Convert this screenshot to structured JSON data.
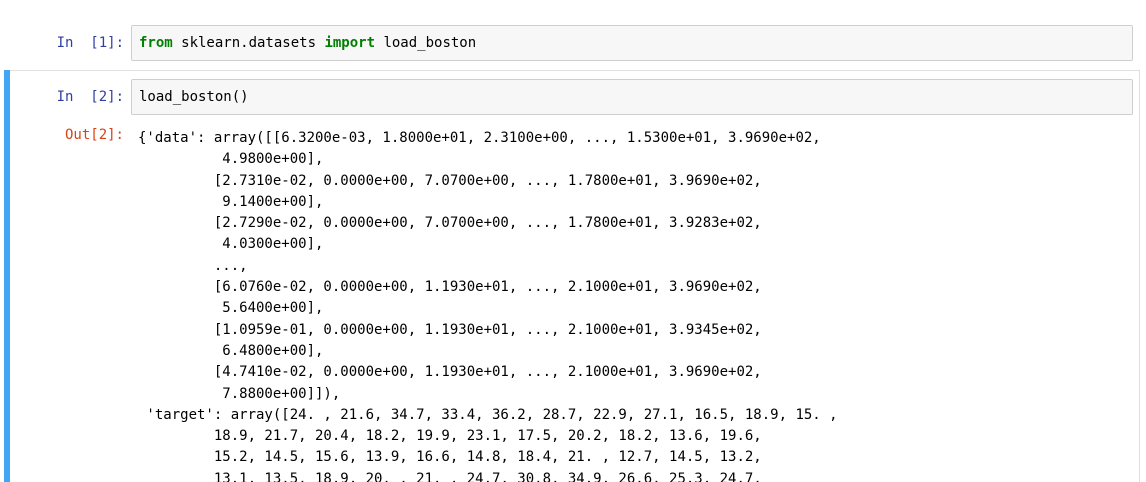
{
  "cells": [
    {
      "prompt_label": "In",
      "prompt_number": "[1]:",
      "code": {
        "kw_from": "from",
        "module": " sklearn.datasets ",
        "kw_import": "import",
        "name": " load_boston"
      }
    },
    {
      "prompt_label": "In",
      "prompt_number": "[2]:",
      "code_text": "load_boston()",
      "out_prompt": "Out[2]:",
      "output": "{'data': array([[6.3200e-03, 1.8000e+01, 2.3100e+00, ..., 1.5300e+01, 3.9690e+02,\n          4.9800e+00],\n         [2.7310e-02, 0.0000e+00, 7.0700e+00, ..., 1.7800e+01, 3.9690e+02,\n          9.1400e+00],\n         [2.7290e-02, 0.0000e+00, 7.0700e+00, ..., 1.7800e+01, 3.9283e+02,\n          4.0300e+00],\n         ...,\n         [6.0760e-02, 0.0000e+00, 1.1930e+01, ..., 2.1000e+01, 3.9690e+02,\n          5.6400e+00],\n         [1.0959e-01, 0.0000e+00, 1.1930e+01, ..., 2.1000e+01, 3.9345e+02,\n          6.4800e+00],\n         [4.7410e-02, 0.0000e+00, 1.1930e+01, ..., 2.1000e+01, 3.9690e+02,\n          7.8800e+00]]),\n 'target': array([24. , 21.6, 34.7, 33.4, 36.2, 28.7, 22.9, 27.1, 16.5, 18.9, 15. ,\n         18.9, 21.7, 20.4, 18.2, 19.9, 23.1, 17.5, 20.2, 18.2, 13.6, 19.6,\n         15.2, 14.5, 15.6, 13.9, 16.6, 14.8, 18.4, 21. , 12.7, 14.5, 13.2,\n         13.1, 13.5, 18.9, 20. , 21. , 24.7, 30.8, 34.9, 26.6, 25.3, 24.7,"
    }
  ],
  "colors": {
    "in_prompt": "#303f9f",
    "out_prompt": "#d84315",
    "keyword": "#008000",
    "selected_cell_bar": "#42a5f5",
    "input_background": "#f7f7f7"
  }
}
